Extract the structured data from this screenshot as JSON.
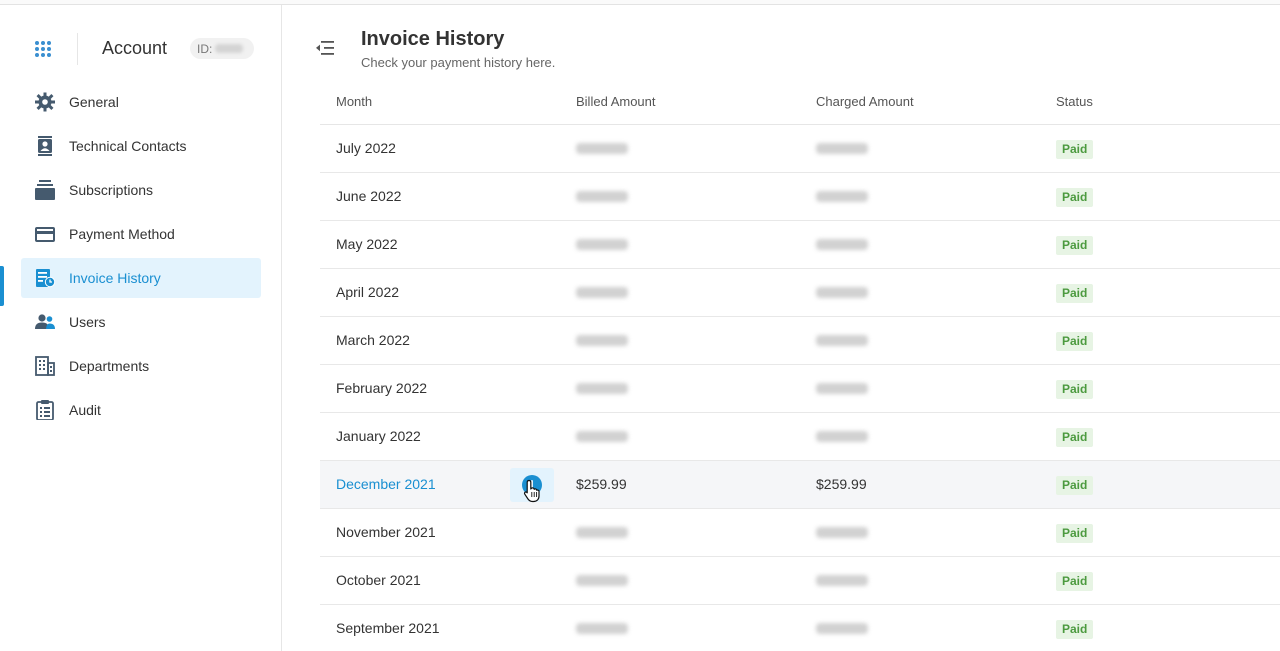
{
  "sidebar": {
    "title": "Account",
    "id_label": "ID:",
    "items": [
      {
        "label": "General",
        "icon": "gear-icon"
      },
      {
        "label": "Technical Contacts",
        "icon": "contact-card-icon"
      },
      {
        "label": "Subscriptions",
        "icon": "stack-icon"
      },
      {
        "label": "Payment Method",
        "icon": "credit-card-icon"
      },
      {
        "label": "Invoice History",
        "icon": "invoice-clock-icon",
        "active": true
      },
      {
        "label": "Users",
        "icon": "users-icon"
      },
      {
        "label": "Departments",
        "icon": "building-icon"
      },
      {
        "label": "Audit",
        "icon": "clipboard-icon"
      }
    ]
  },
  "header": {
    "title": "Invoice History",
    "subtitle": "Check your payment history here."
  },
  "table": {
    "columns": [
      "Month",
      "Billed Amount",
      "Charged Amount",
      "Status"
    ],
    "rows": [
      {
        "month": "July 2022",
        "billed": "",
        "charged": "",
        "status": "Paid"
      },
      {
        "month": "June 2022",
        "billed": "",
        "charged": "",
        "status": "Paid"
      },
      {
        "month": "May 2022",
        "billed": "",
        "charged": "",
        "status": "Paid"
      },
      {
        "month": "April 2022",
        "billed": "",
        "charged": "",
        "status": "Paid"
      },
      {
        "month": "March 2022",
        "billed": "",
        "charged": "",
        "status": "Paid"
      },
      {
        "month": "February 2022",
        "billed": "",
        "charged": "",
        "status": "Paid"
      },
      {
        "month": "January 2022",
        "billed": "",
        "charged": "",
        "status": "Paid"
      },
      {
        "month": "December 2021",
        "billed": "$259.99",
        "charged": "$259.99",
        "status": "Paid"
      },
      {
        "month": "November 2021",
        "billed": "",
        "charged": "",
        "status": "Paid"
      },
      {
        "month": "October 2021",
        "billed": "",
        "charged": "",
        "status": "Paid"
      },
      {
        "month": "September 2021",
        "billed": "",
        "charged": "",
        "status": "Paid"
      }
    ]
  },
  "colors": {
    "accent": "#1a8fd1",
    "active_bg": "#e3f3fd",
    "paid_bg": "#e7f4e4",
    "paid_text": "#4c9a3f"
  }
}
